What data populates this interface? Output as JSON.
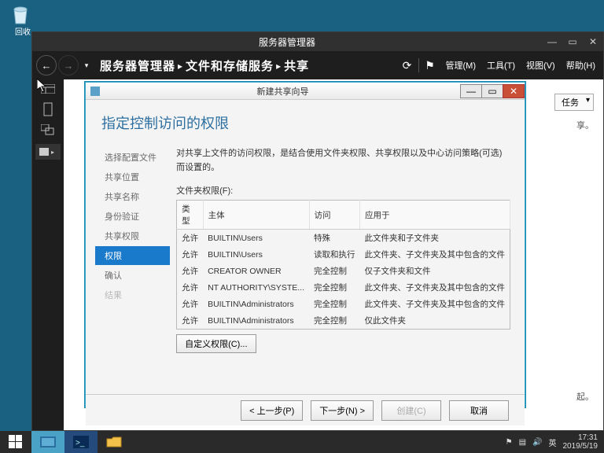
{
  "desktop": {
    "recycle_bin_label": "回收"
  },
  "server_manager": {
    "title": "服务器管理器",
    "breadcrumb": {
      "root": "服务器管理器",
      "l2": "文件和存储服务",
      "l3": "共享"
    },
    "menu": {
      "manage": "管理(M)",
      "tools": "工具(T)",
      "view": "视图(V)",
      "help": "帮助(H)"
    },
    "tasks_label": "任务",
    "hint_top": "享。",
    "hint_bottom": "起。"
  },
  "wizard": {
    "title": "新建共享向导",
    "heading": "指定控制访问的权限",
    "nav": [
      {
        "label": "选择配置文件"
      },
      {
        "label": "共享位置"
      },
      {
        "label": "共享名称"
      },
      {
        "label": "身份验证"
      },
      {
        "label": "共享权限"
      },
      {
        "label": "权限",
        "selected": true
      },
      {
        "label": "确认"
      },
      {
        "label": "结果",
        "disabled": true
      }
    ],
    "description": "对共享上文件的访问权限，是结合使用文件夹权限、共享权限以及中心访问策略(可选)而设置的。",
    "folder_perm_label": "文件夹权限(F):",
    "columns": {
      "type": "类型",
      "principal": "主体",
      "access": "访问",
      "applied": "应用于"
    },
    "rows": [
      {
        "type": "允许",
        "principal": "BUILTIN\\Users",
        "access": "特殊",
        "applied": "此文件夹和子文件夹"
      },
      {
        "type": "允许",
        "principal": "BUILTIN\\Users",
        "access": "读取和执行",
        "applied": "此文件夹、子文件夹及其中包含的文件"
      },
      {
        "type": "允许",
        "principal": "CREATOR OWNER",
        "access": "完全控制",
        "applied": "仅子文件夹和文件"
      },
      {
        "type": "允许",
        "principal": "NT AUTHORITY\\SYSTE...",
        "access": "完全控制",
        "applied": "此文件夹、子文件夹及其中包含的文件"
      },
      {
        "type": "允许",
        "principal": "BUILTIN\\Administrators",
        "access": "完全控制",
        "applied": "此文件夹、子文件夹及其中包含的文件"
      },
      {
        "type": "允许",
        "principal": "BUILTIN\\Administrators",
        "access": "完全控制",
        "applied": "仅此文件夹"
      }
    ],
    "custom_perm_btn": "自定义权限(C)...",
    "buttons": {
      "prev": "< 上一步(P)",
      "next": "下一步(N) >",
      "create": "创建(C)",
      "cancel": "取消"
    }
  },
  "taskbar": {
    "ime": "英",
    "time": "17:31",
    "date": "2019/5/19"
  }
}
